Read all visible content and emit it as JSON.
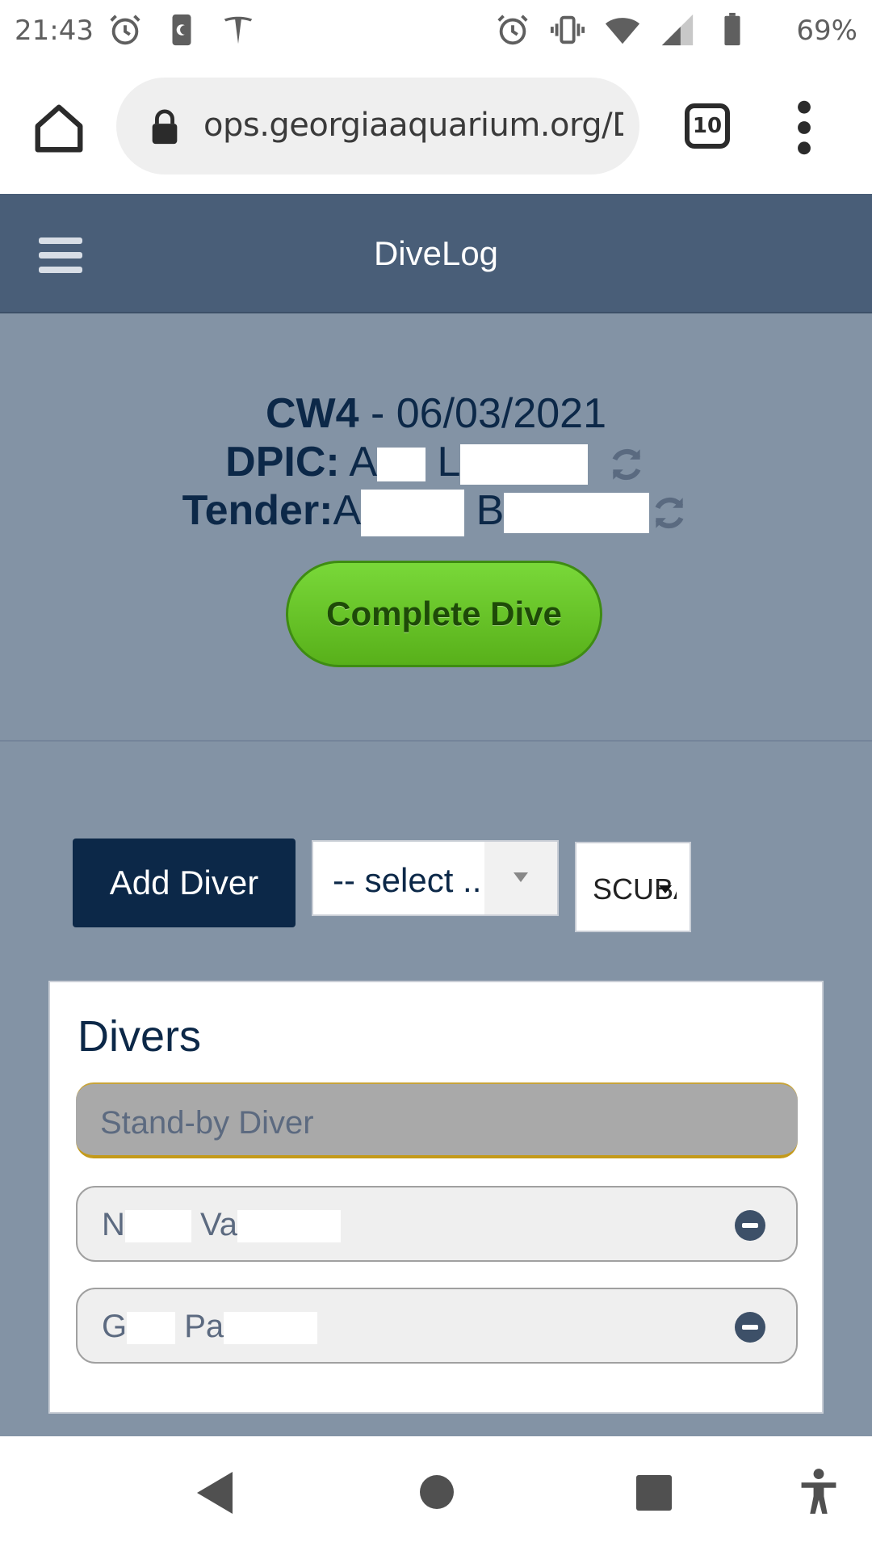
{
  "status_bar": {
    "time": "21:43",
    "battery": "69%",
    "left_icons": [
      "alarm-icon",
      "do-not-disturb-icon",
      "tesla-icon"
    ],
    "right_icons": [
      "alarm-icon",
      "vibrate-icon",
      "wifi-icon",
      "signal-icon",
      "battery-icon"
    ]
  },
  "browser": {
    "url": "ops.georgiaaquarium.org/Di",
    "tab_count": "10"
  },
  "app": {
    "title": "DiveLog"
  },
  "dive": {
    "site": "CW4",
    "separator": " - ",
    "date": "06/03/2021",
    "dpic_label": "DPIC:",
    "dpic_name_first_initial": "A",
    "dpic_name_last_initial": "L",
    "tender_label": "Tender:",
    "tender_name_first_initial": "A",
    "tender_name_last_initial": "B",
    "complete_button": "Complete Dive"
  },
  "add_diver": {
    "button": "Add Diver",
    "select_value": "-- select ...",
    "type_value": "SCUBA"
  },
  "divers": {
    "title": "Divers",
    "standby_placeholder": "Stand-by Diver",
    "rows": [
      {
        "first_initial": "N",
        "last_initial": "Va"
      },
      {
        "first_initial": "G",
        "last_initial": "Pa"
      }
    ]
  },
  "colors": {
    "header": "#495e78",
    "panel": "#8393a5",
    "navy": "#0c2848",
    "complete_green": "#6cc82c"
  }
}
